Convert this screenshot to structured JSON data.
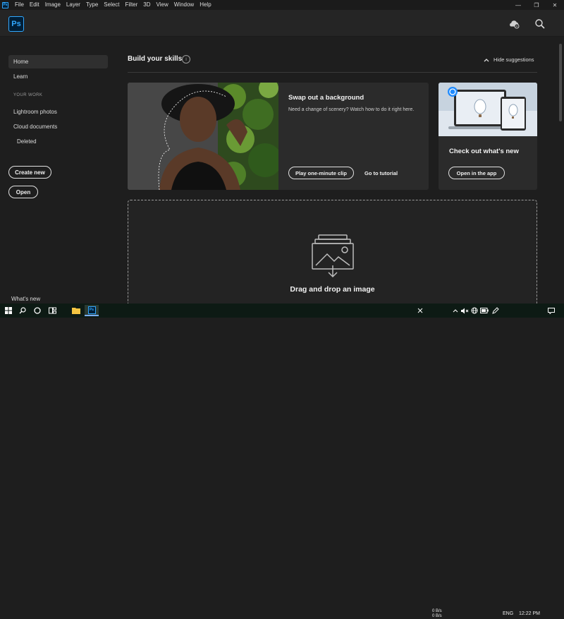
{
  "menubar": {
    "app_icon": "Ps",
    "items": [
      "File",
      "Edit",
      "Image",
      "Layer",
      "Type",
      "Select",
      "Filter",
      "3D",
      "View",
      "Window",
      "Help"
    ],
    "controls": {
      "minimize": "—",
      "restore": "❐",
      "close": "✕"
    }
  },
  "header": {
    "logo": "Ps",
    "cloud_icon": "cloud-sync-icon",
    "search_icon": "search-icon"
  },
  "sidebar": {
    "home": "Home",
    "learn": "Learn",
    "your_work_heading": "YOUR WORK",
    "lightroom": "Lightroom photos",
    "cloud_docs": "Cloud documents",
    "deleted": "Deleted",
    "create_new": "Create new",
    "open": "Open",
    "whats_new": "What's new"
  },
  "main": {
    "section_title": "Build your skills",
    "hide_suggestions": "Hide suggestions",
    "card1": {
      "title": "Swap out a background",
      "desc": "Need a change of scenery? Watch how to do it right here.",
      "primary_btn": "Play one-minute clip",
      "link": "Go to tutorial"
    },
    "card2": {
      "title": "Check out what's new",
      "btn": "Open in the app"
    },
    "dropzone": {
      "title": "Drag and drop an image"
    }
  },
  "taskbar": {
    "net_up": "0 B/s",
    "net_down": "0 B/s",
    "lang": "ENG",
    "time": "12:22 PM"
  },
  "colors": {
    "accent": "#31a8ff",
    "ps_bg": "#001e36",
    "background": "#1e1e1e",
    "card": "#2b2b2b"
  }
}
